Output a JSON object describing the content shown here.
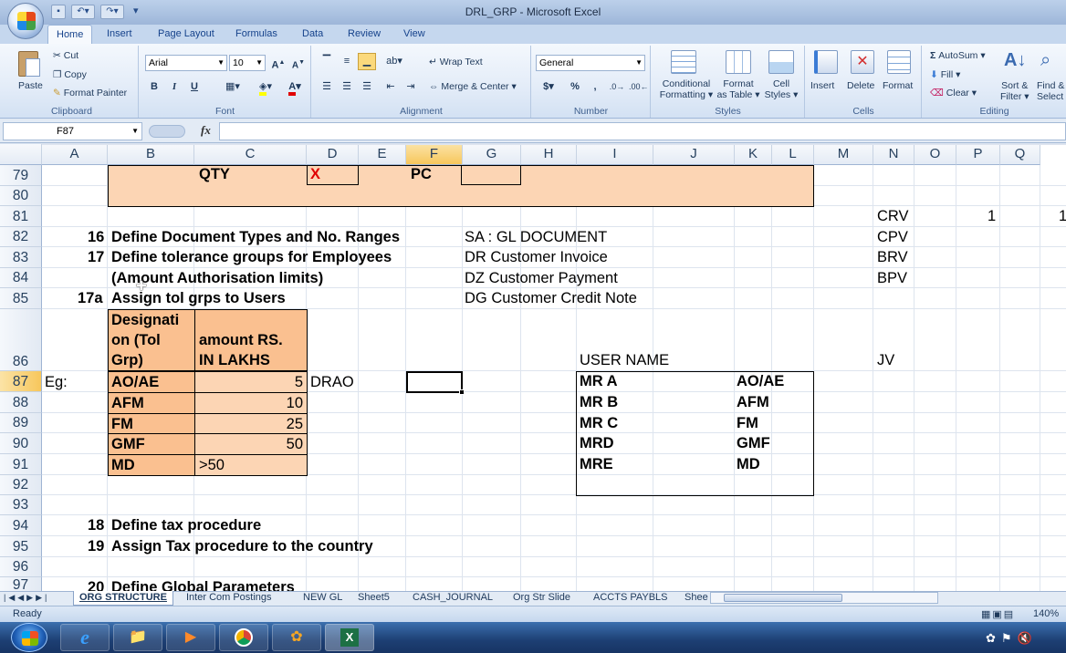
{
  "window": {
    "title": "DRL_GRP - Microsoft Excel"
  },
  "tabs": [
    "Home",
    "Insert",
    "Page Layout",
    "Formulas",
    "Data",
    "Review",
    "View"
  ],
  "ribbon": {
    "clipboard": {
      "paste": "Paste",
      "cut": "Cut",
      "copy": "Copy",
      "format_painter": "Format Painter",
      "label": "Clipboard"
    },
    "font": {
      "name": "Arial",
      "size": "10",
      "label": "Font",
      "bold": "B",
      "italic": "I",
      "underline": "U"
    },
    "alignment": {
      "wrap": "Wrap Text",
      "merge": "Merge & Center",
      "label": "Alignment"
    },
    "number": {
      "format": "General",
      "label": "Number",
      "currency": "$",
      "percent": "%",
      "comma": ","
    },
    "styles": {
      "cond1": "Conditional",
      "cond2": "Formatting",
      "table1": "Format",
      "table2": "as Table",
      "cell1": "Cell",
      "cell2": "Styles",
      "label": "Styles"
    },
    "cells": {
      "insert": "Insert",
      "delete": "Delete",
      "format": "Format",
      "label": "Cells"
    },
    "editing": {
      "autosum": "AutoSum",
      "fill": "Fill",
      "clear": "Clear",
      "sort1": "Sort &",
      "sort2": "Filter",
      "find1": "Find &",
      "find2": "Select",
      "label": "Editing"
    }
  },
  "formula_bar": {
    "name_box": "F87",
    "fx": "fx",
    "value": ""
  },
  "columns": [
    "A",
    "B",
    "C",
    "D",
    "E",
    "F",
    "G",
    "H",
    "I",
    "J",
    "K",
    "L",
    "M",
    "N",
    "O",
    "P",
    "Q"
  ],
  "selected_column": "F",
  "rows": [
    "79",
    "80",
    "81",
    "82",
    "83",
    "84",
    "85",
    "86",
    "87",
    "88",
    "89",
    "90",
    "91",
    "92",
    "93",
    "94",
    "95",
    "96",
    "97"
  ],
  "selected_row": "87",
  "cells": {
    "qty": "QTY",
    "x": "X",
    "pc": "PC",
    "n16": "16",
    "t16": "Define Document Types and No. Ranges",
    "n17": "17",
    "t17": "Define tolerance groups for Employees",
    "t17b": "(Amount Authorisation limits)",
    "n17a": "17a",
    "t17a": "Assign  tol  grps to Users",
    "sa": "SA : GL DOCUMENT",
    "dr": "DR Customer Invoice",
    "dz": "DZ Customer Payment",
    "dg": "DG Customer Credit Note",
    "crv": "CRV",
    "cpv": "CPV",
    "brv": "BRV",
    "bpv": "BPV",
    "jv": "JV",
    "p81": "1",
    "q81": "1",
    "hdr_desig": "Designati on (Tol Grp)",
    "hdr_desig1": "Designati",
    "hdr_desig2": "on (Tol",
    "hdr_desig3": "Grp)",
    "hdr_amt1": "amount  RS.",
    "hdr_amt2": "IN LAKHS",
    "eg": "Eg:",
    "drao": "DRAO",
    "tol_rows": [
      {
        "grp": "AO/AE",
        "amt": "5"
      },
      {
        "grp": "AFM",
        "amt": "10"
      },
      {
        "grp": "FM",
        "amt": "25"
      },
      {
        "grp": "GMF",
        "amt": "50"
      },
      {
        "grp": "MD",
        "amt": ">50"
      }
    ],
    "user_name": "USER NAME",
    "users": [
      {
        "name": "MR A",
        "grp": "AO/AE"
      },
      {
        "name": "MR B",
        "grp": "AFM"
      },
      {
        "name": "MR C",
        "grp": "FM"
      },
      {
        "name": "MRD",
        "grp": "GMF"
      },
      {
        "name": "MRE",
        "grp": "MD"
      }
    ],
    "n18": "18",
    "t18": "Define tax procedure",
    "n19": "19",
    "t19": "Assign Tax procedure to the country",
    "n20": "20",
    "t20": "Define Global Parameters"
  },
  "sheet_tabs": [
    "ORG STRUCTURE",
    "Inter Com Postings",
    "NEW GL",
    "Sheet5",
    "CASH_JOURNAL",
    "Org Str Slide",
    "ACCTS PAYBLS",
    "Shee"
  ],
  "status": {
    "ready": "Ready",
    "zoom": "140%"
  }
}
